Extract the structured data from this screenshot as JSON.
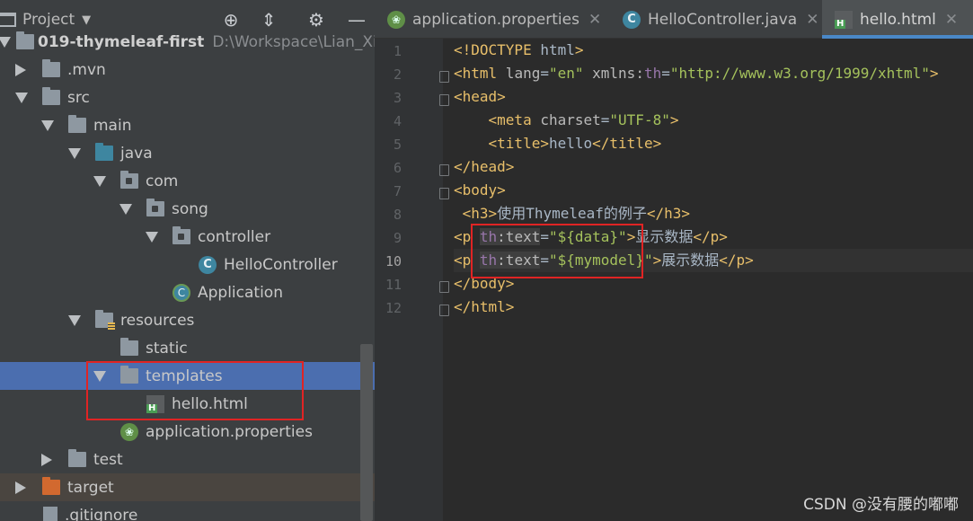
{
  "project_panel": {
    "title": "Project",
    "toolbar_icons": [
      "crosshair-icon",
      "collapse-icon",
      "gear-icon",
      "minimize-icon"
    ],
    "tree": [
      {
        "label": "019-thymeleaf-first",
        "path": "D:\\Workspace\\Lian_Xi\\Sp",
        "icon": "module-folder",
        "expanded": true,
        "depth": 0
      },
      {
        "label": ".mvn",
        "icon": "folder",
        "expanded": false,
        "depth": 1
      },
      {
        "label": "src",
        "icon": "folder",
        "expanded": true,
        "depth": 1
      },
      {
        "label": "main",
        "icon": "folder",
        "expanded": true,
        "depth": 2
      },
      {
        "label": "java",
        "icon": "source-folder",
        "expanded": true,
        "depth": 3
      },
      {
        "label": "com",
        "icon": "package",
        "expanded": true,
        "depth": 4
      },
      {
        "label": "song",
        "icon": "package",
        "expanded": true,
        "depth": 5
      },
      {
        "label": "controller",
        "icon": "package",
        "expanded": true,
        "depth": 6
      },
      {
        "label": "HelloController",
        "icon": "class",
        "depth": 7
      },
      {
        "label": "Application",
        "icon": "spring-class",
        "depth": 6
      },
      {
        "label": "resources",
        "icon": "resources-folder",
        "expanded": true,
        "depth": 3
      },
      {
        "label": "static",
        "icon": "folder",
        "depth": 4
      },
      {
        "label": "templates",
        "icon": "folder",
        "expanded": true,
        "depth": 4,
        "selected": true
      },
      {
        "label": "hello.html",
        "icon": "html-file",
        "depth": 5
      },
      {
        "label": "application.properties",
        "icon": "spring-properties",
        "depth": 4
      },
      {
        "label": "test",
        "icon": "folder",
        "expanded": false,
        "depth": 2
      },
      {
        "label": "target",
        "icon": "excluded-folder",
        "expanded": false,
        "depth": 1
      },
      {
        "label": ".gitignore",
        "icon": "file",
        "depth": 1
      }
    ]
  },
  "editor": {
    "tabs": [
      {
        "label": "application.properties",
        "icon": "spring-properties-icon",
        "active": false
      },
      {
        "label": "HelloController.java",
        "icon": "class-icon",
        "active": false
      },
      {
        "label": "hello.html",
        "icon": "html-file-icon",
        "active": true
      }
    ],
    "current_line": 10,
    "lines": [
      {
        "n": "1",
        "text": "<!DOCTYPE html>"
      },
      {
        "n": "2",
        "text": "<html lang=\"en\" xmlns:th=\"http://www.w3.org/1999/xhtml\">"
      },
      {
        "n": "3",
        "text": "<head>"
      },
      {
        "n": "4",
        "text": "    <meta charset=\"UTF-8\">"
      },
      {
        "n": "5",
        "text": "    <title>hello</title>"
      },
      {
        "n": "6",
        "text": "</head>"
      },
      {
        "n": "7",
        "text": "<body>"
      },
      {
        "n": "8",
        "text": " <h3>使用Thymeleaf的例子</h3>"
      },
      {
        "n": "9",
        "text": "<p th:text=\"${data}\">显示数据</p>"
      },
      {
        "n": "10",
        "text": "<p th:text=\"${mymodel}\">展示数据</p>"
      },
      {
        "n": "11",
        "text": "</body>"
      },
      {
        "n": "12",
        "text": "</html>"
      }
    ]
  },
  "watermark": "CSDN @没有腰的嘟嘟",
  "colors": {
    "selection": "#4b6eaf",
    "annotation_box": "#e02424",
    "tag": "#e8bf6a",
    "string": "#a5c25c",
    "namespace": "#9876aa"
  }
}
